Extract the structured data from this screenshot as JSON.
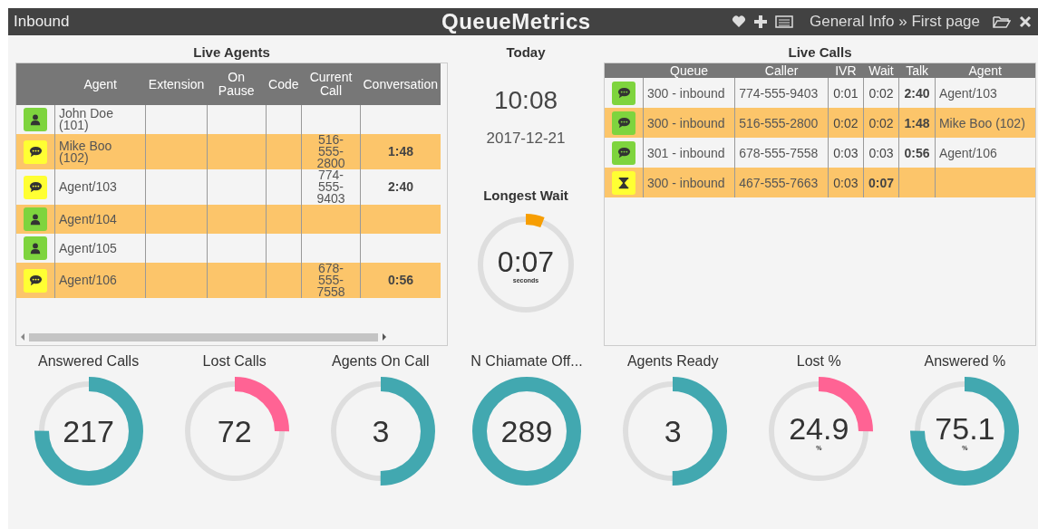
{
  "header": {
    "title": "Inbound",
    "brand": "QueueMetrics",
    "breadcrumb": "General Info » First page"
  },
  "live_agents": {
    "title": "Live Agents",
    "columns": [
      "Agent",
      "Extension",
      "On Pause",
      "Code",
      "Current Call",
      "Conversation"
    ],
    "rows": [
      {
        "kind": "idle",
        "agent": "John Doe (101)",
        "extension": "",
        "on_pause": "",
        "code": "",
        "current_call": "",
        "conversation": ""
      },
      {
        "kind": "talking",
        "agent": "Mike Boo (102)",
        "current_call": "516-555-2800",
        "conversation": "1:48"
      },
      {
        "kind": "talking",
        "agent": "Agent/103",
        "current_call": "774-555-9403",
        "conversation": "2:40"
      },
      {
        "kind": "idle",
        "agent": "Agent/104",
        "current_call": "",
        "conversation": ""
      },
      {
        "kind": "idle",
        "agent": "Agent/105",
        "current_call": "",
        "conversation": ""
      },
      {
        "kind": "talking",
        "agent": "Agent/106",
        "current_call": "678-555-7558",
        "conversation": "0:56"
      }
    ]
  },
  "today": {
    "title": "Today",
    "time": "10:08",
    "date": "2017-12-21"
  },
  "longest_wait": {
    "title": "Longest Wait",
    "value": "0:07",
    "unit": "seconds",
    "level": 0.06,
    "color": "#f79e02"
  },
  "live_calls": {
    "title": "Live Calls",
    "columns": [
      "Queue",
      "Caller",
      "IVR",
      "Wait",
      "Talk",
      "Agent"
    ],
    "rows": [
      {
        "kind": "talking",
        "queue": "300 - inbound",
        "caller": "774-555-9403",
        "ivr": "0:01",
        "wait": "0:02",
        "talk": "2:40",
        "agent": "Agent/103"
      },
      {
        "kind": "talking",
        "queue": "300 - inbound",
        "caller": "516-555-2800",
        "ivr": "0:02",
        "wait": "0:02",
        "talk": "1:48",
        "agent": "Mike Boo (102)"
      },
      {
        "kind": "talking",
        "queue": "301 - inbound",
        "caller": "678-555-7558",
        "ivr": "0:03",
        "wait": "0:03",
        "talk": "0:56",
        "agent": "Agent/106"
      },
      {
        "kind": "waiting",
        "queue": "300 - inbound",
        "caller": "467-555-7663",
        "ivr": "0:03",
        "wait": "0:07",
        "talk": "",
        "agent": ""
      }
    ]
  },
  "gauges": [
    {
      "title": "Answered Calls",
      "value": "217",
      "level": 0.75,
      "color": "#42a8b0"
    },
    {
      "title": "Lost Calls",
      "value": "72",
      "level": 0.25,
      "color": "#ff6394"
    },
    {
      "title": "Agents On Call",
      "value": "3",
      "level": 0.5,
      "color": "#42a8b0"
    },
    {
      "title": "N Chiamate Off...",
      "value": "289",
      "level": 1,
      "color": "#42a8b0"
    },
    {
      "title": "Agents Ready",
      "value": "3",
      "level": 0.5,
      "color": "#42a8b0"
    },
    {
      "title": "Lost %",
      "value": "24.9",
      "unit": "%",
      "level": 0.25,
      "color": "#ff6394"
    },
    {
      "title": "Answered %",
      "value": "75.1",
      "unit": "%",
      "level": 0.75,
      "color": "#42a8b0"
    }
  ]
}
